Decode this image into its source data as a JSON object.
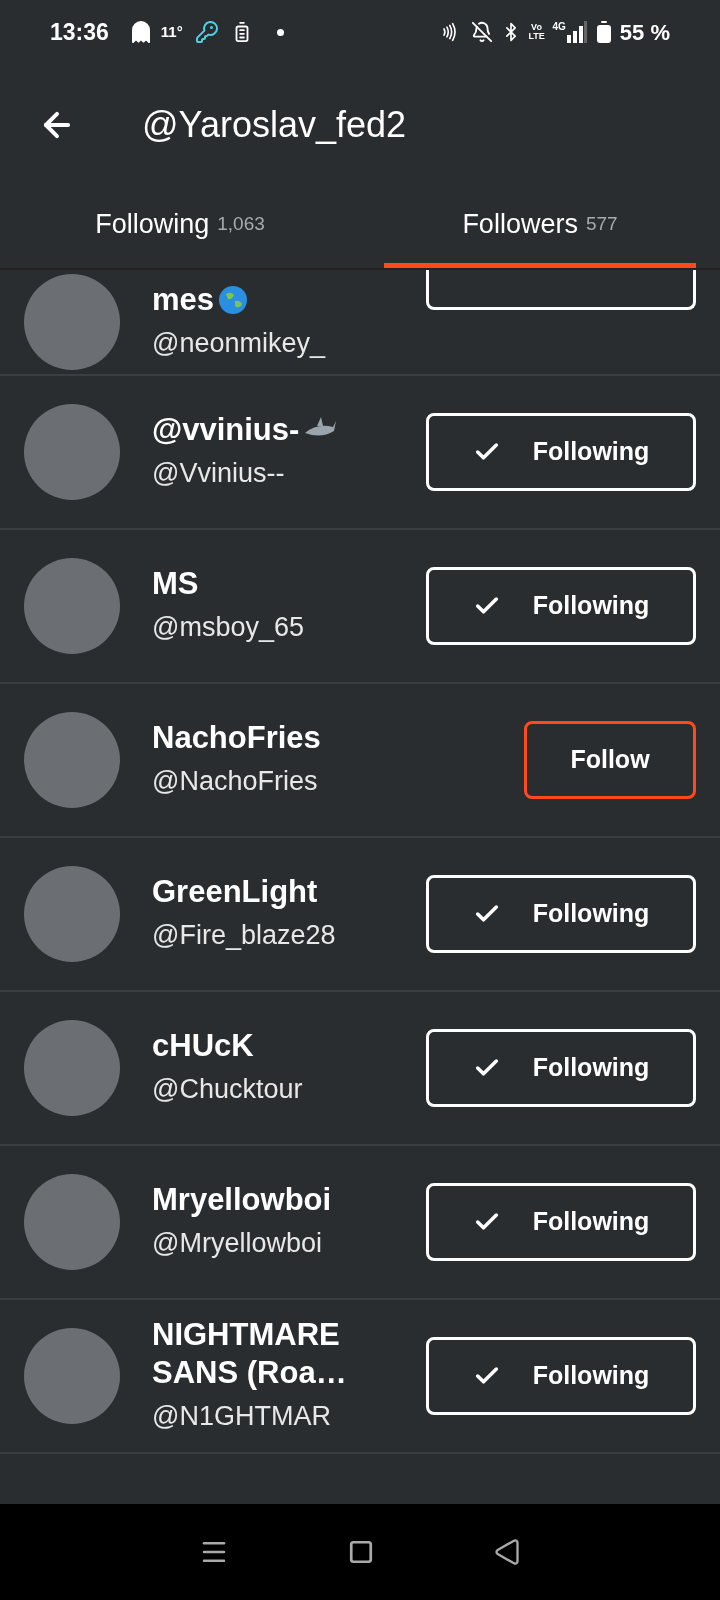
{
  "status_bar": {
    "time": "13:36",
    "temperature": "11°",
    "volte": "Vo LTE",
    "network": "4G",
    "battery": "55 %"
  },
  "header": {
    "title": "@Yaroslav_fed2"
  },
  "tabs": [
    {
      "label": "Following",
      "count": "1,063",
      "selected": false
    },
    {
      "label": "Followers",
      "count": "577",
      "selected": true
    }
  ],
  "users": [
    {
      "name": "mes",
      "kind": "globe",
      "handle": "@neonmikey_",
      "following": true,
      "partial": true
    },
    {
      "name": "@vvinius-",
      "kind": "shark",
      "handle": "@Vvinius--",
      "following": true,
      "partial": false,
      "button": "Following"
    },
    {
      "name": "MS",
      "kind": "plain",
      "handle": "@msboy_65",
      "following": true,
      "partial": false,
      "button": "Following"
    },
    {
      "name": "NachoFries",
      "kind": "plain",
      "handle": "@NachoFries",
      "following": false,
      "partial": false,
      "button": "Follow"
    },
    {
      "name": "GreenLight",
      "kind": "plain",
      "handle": "@Fire_blaze28",
      "following": true,
      "partial": false,
      "button": "Following"
    },
    {
      "name": "cHUcK",
      "kind": "plain",
      "handle": "@Chucktour",
      "following": true,
      "partial": false,
      "button": "Following"
    },
    {
      "name": "Mryellowboi",
      "kind": "plain",
      "handle": "@Mryellowboi",
      "following": true,
      "partial": false,
      "button": "Following"
    },
    {
      "name": "NIGHTMARE SANS (Roa…",
      "kind": "plain",
      "handle": "@N1GHTMAR",
      "following": true,
      "partial": false,
      "button": "Following"
    }
  ]
}
